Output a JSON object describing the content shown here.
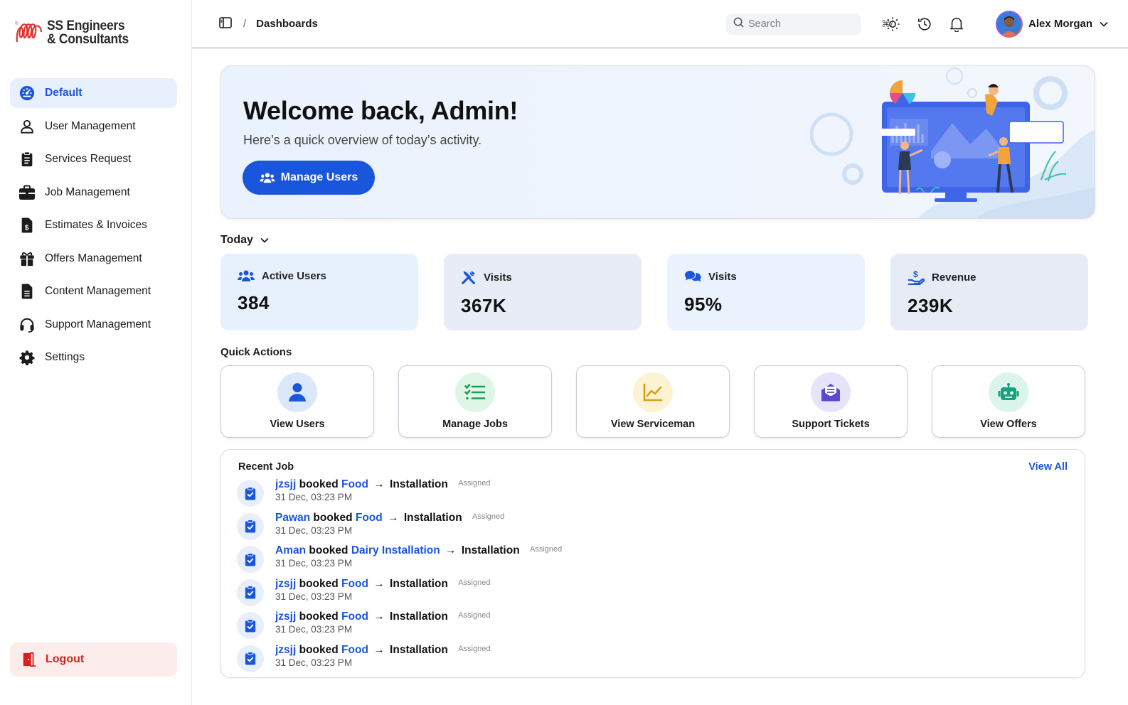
{
  "brand": {
    "line1": "SS Engineers",
    "line2": "& Consultants"
  },
  "sidebar": {
    "items": [
      {
        "label": "Default",
        "icon": "dashboard-gauge-icon",
        "active": true
      },
      {
        "label": "User Management",
        "icon": "user-icon"
      },
      {
        "label": "Services Request",
        "icon": "clipboard-list-icon"
      },
      {
        "label": "Job Management",
        "icon": "briefcase-icon"
      },
      {
        "label": "Estimates & Invoices",
        "icon": "invoice-dollar-icon"
      },
      {
        "label": "Offers Management",
        "icon": "gift-icon"
      },
      {
        "label": "Content Management",
        "icon": "document-icon"
      },
      {
        "label": "Support Management",
        "icon": "headset-icon"
      },
      {
        "label": "Settings",
        "icon": "gear-icon"
      }
    ],
    "logout": "Logout"
  },
  "topbar": {
    "breadcrumb_sep": "/",
    "breadcrumb": "Dashboards",
    "search_placeholder": "Search",
    "search_shortcut": "⌘/",
    "user_name": "Alex Morgan"
  },
  "hero": {
    "title": "Welcome back, Admin!",
    "subtitle": "Here’s a quick overview of today’s activity.",
    "button": "Manage Users"
  },
  "period": "Today",
  "stats": [
    {
      "label": "Active Users",
      "value": "384",
      "icon": "users-icon"
    },
    {
      "label": "Visits",
      "value": "367K",
      "icon": "tools-icon"
    },
    {
      "label": "Visits",
      "value": "95%",
      "icon": "chat-bubbles-icon"
    },
    {
      "label": "Revenue",
      "value": "239K",
      "icon": "hand-dollar-icon"
    }
  ],
  "quick_actions": {
    "title": "Quick Actions",
    "items": [
      {
        "label": "View Users",
        "icon": "user-icon",
        "color": "#dbe7fb"
      },
      {
        "label": "Manage Jobs",
        "icon": "checklist-icon",
        "color": "#dff5e6"
      },
      {
        "label": "View Serviceman",
        "icon": "line-chart-icon",
        "color": "#fdf3d2"
      },
      {
        "label": "Support Tickets",
        "icon": "envelope-icon",
        "color": "#e6e4fb"
      },
      {
        "label": "View Offers",
        "icon": "robot-icon",
        "color": "#dcf5ec"
      }
    ]
  },
  "recent": {
    "title": "Recent Job",
    "view_all": "View All",
    "booked_word": "booked",
    "arrow": "→",
    "rows": [
      {
        "user": "jzsjj",
        "service": "Food",
        "type": "Installation",
        "status": "Assigned",
        "time": "31 Dec, 03:23 PM"
      },
      {
        "user": "Pawan",
        "service": "Food",
        "type": "Installation",
        "status": "Assigned",
        "time": "31 Dec, 03:23 PM"
      },
      {
        "user": "Aman",
        "service": "Dairy Installation",
        "type": "Installation",
        "status": "Assigned",
        "time": "31 Dec, 03:23 PM"
      },
      {
        "user": "jzsjj",
        "service": "Food",
        "type": "Installation",
        "status": "Assigned",
        "time": "31 Dec, 03:23 PM"
      },
      {
        "user": "jzsjj",
        "service": "Food",
        "type": "Installation",
        "status": "Assigned",
        "time": "31 Dec, 03:23 PM"
      },
      {
        "user": "jzsjj",
        "service": "Food",
        "type": "Installation",
        "status": "Assigned",
        "time": "31 Dec, 03:23 PM"
      }
    ]
  },
  "colors": {
    "primary": "#1a56db",
    "danger": "#d92020",
    "active_bg": "#e9f0fd"
  }
}
